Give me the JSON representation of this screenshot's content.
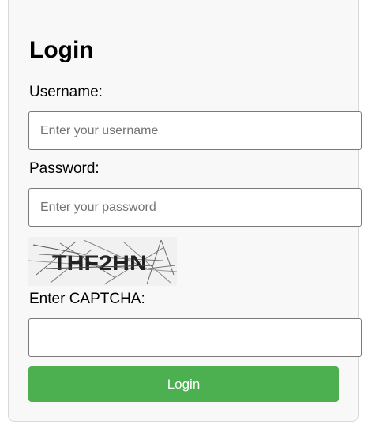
{
  "form": {
    "title": "Login",
    "username_label": "Username:",
    "username_placeholder": "Enter your username",
    "username_value": "",
    "password_label": "Password:",
    "password_placeholder": "Enter your password",
    "password_value": "",
    "captcha_text": "THF2HN",
    "captcha_label": "Enter CAPTCHA:",
    "captcha_value": "",
    "login_label": "Login"
  },
  "colors": {
    "button_bg": "#4caf50",
    "card_bg": "#f8f8f8"
  }
}
